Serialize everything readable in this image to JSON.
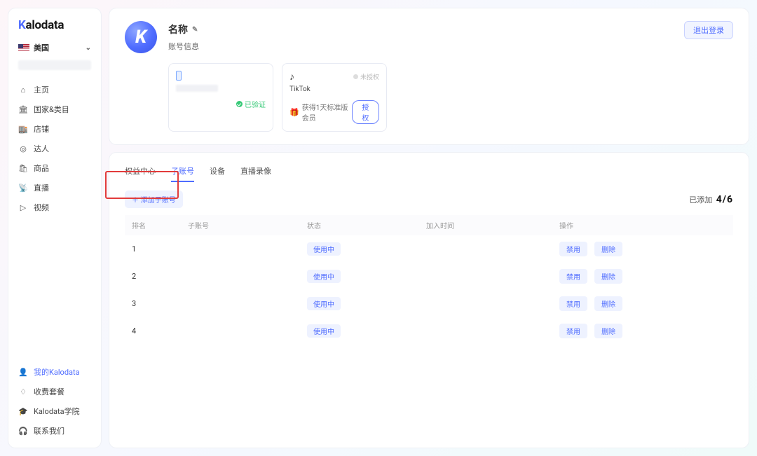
{
  "brand": {
    "prefix": "K",
    "rest": "alodata"
  },
  "country": {
    "label": "美国"
  },
  "nav": {
    "home": "主页",
    "country_category": "国家&类目",
    "shop": "店铺",
    "creator": "达人",
    "product": "商品",
    "live": "直播",
    "video": "视频"
  },
  "bottom": {
    "my_kalodata": "我的Kalodata",
    "pricing": "收费套餐",
    "academy": "Kalodata学院",
    "contact": "联系我们"
  },
  "profile": {
    "avatar_letter": "K",
    "name_label": "名称",
    "account_info": "账号信息",
    "verified": "已验证",
    "tiktok": "TikTok",
    "unauthorized": "未授权",
    "gift_text": "获得1天标准版会员",
    "authorize": "授权",
    "logout": "退出登录"
  },
  "tabs": {
    "rights_center": "权益中心",
    "sub_account": "子账号",
    "device": "设备",
    "live_record": "直播录像"
  },
  "toolbar": {
    "add_sub": "添加子账号",
    "added_prefix": "已添加",
    "added_count": "4/6"
  },
  "columns": {
    "rank": "排名",
    "sub": "子账号",
    "status": "状态",
    "join_time": "加入时间",
    "ops": "操作"
  },
  "rows": [
    {
      "rank": "1",
      "status": "使用中"
    },
    {
      "rank": "2",
      "status": "使用中"
    },
    {
      "rank": "3",
      "status": "使用中"
    },
    {
      "rank": "4",
      "status": "使用中"
    }
  ],
  "ops": {
    "disable": "禁用",
    "delete": "删除"
  }
}
